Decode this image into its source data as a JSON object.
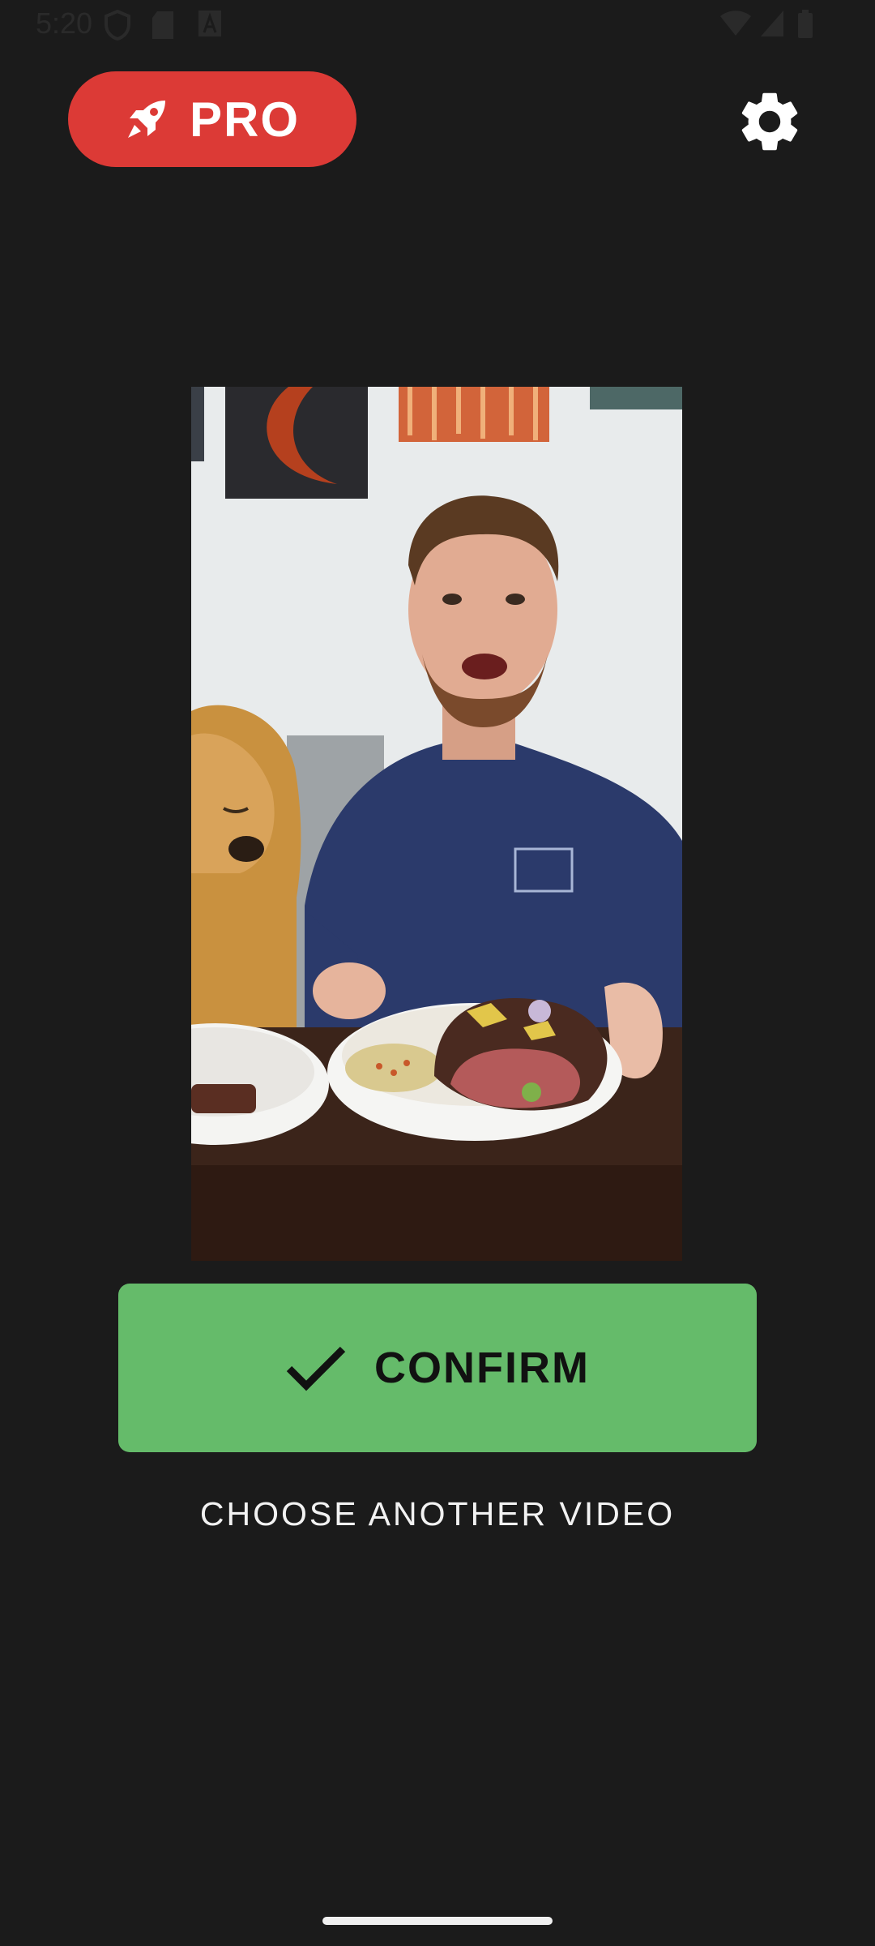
{
  "status_bar": {
    "time": "5:20",
    "left_icons": [
      "shield-icon",
      "sd-card-icon",
      "font-a-icon"
    ],
    "right_icons": [
      "wifi-icon",
      "signal-icon",
      "battery-icon"
    ]
  },
  "header": {
    "pro_label": "PRO",
    "pro_icon": "rocket-icon",
    "settings_icon": "gear-icon"
  },
  "preview": {
    "thumbnail": "video-thumbnail"
  },
  "actions": {
    "confirm_label": "CONFIRM",
    "confirm_icon": "checkmark-icon",
    "choose_another_label": "CHOOSE ANOTHER VIDEO"
  },
  "colors": {
    "background": "#1b1b1b",
    "pro_red": "#dc3a36",
    "confirm_green": "#65bb6a"
  }
}
